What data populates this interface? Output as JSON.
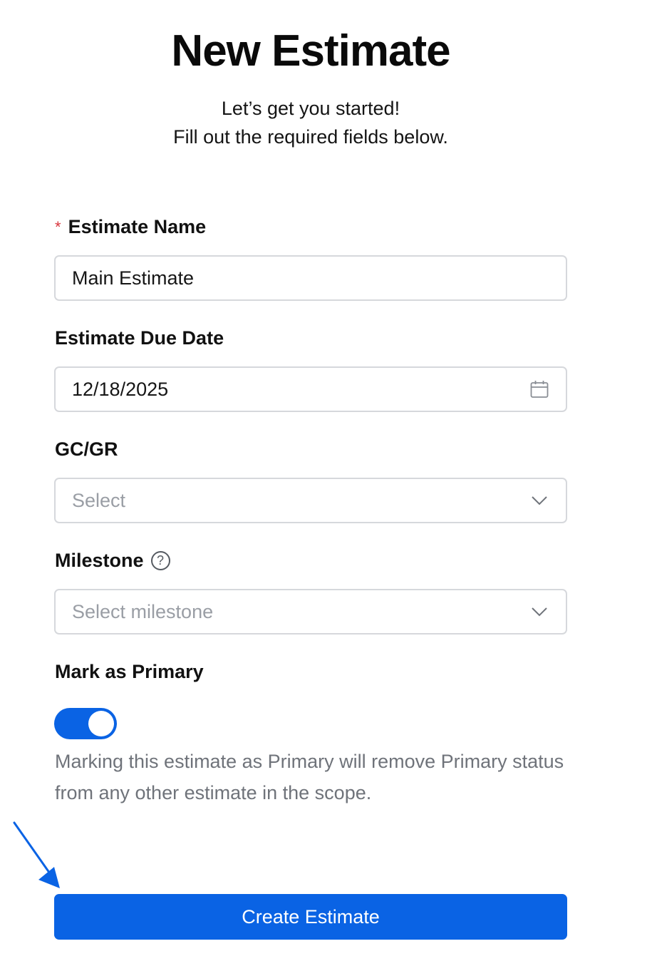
{
  "header": {
    "title": "New Estimate",
    "subtitle_line1": "Let’s get you started!",
    "subtitle_line2": "Fill out the required fields below."
  },
  "form": {
    "estimate_name": {
      "required_marker": "*",
      "label": "Estimate Name",
      "value": "Main Estimate"
    },
    "due_date": {
      "label": "Estimate Due Date",
      "value": "12/18/2025",
      "icon": "calendar-icon"
    },
    "gc_gr": {
      "label": "GC/GR",
      "placeholder": "Select",
      "icon": "chevron-down-icon"
    },
    "milestone": {
      "label": "Milestone",
      "help_glyph": "?",
      "placeholder": "Select milestone",
      "icon": "chevron-down-icon"
    },
    "primary": {
      "label": "Mark as Primary",
      "enabled": true,
      "helper_text": "Marking this estimate as Primary will remove Primary status from any other estimate in the scope."
    }
  },
  "actions": {
    "create_label": "Create Estimate"
  },
  "colors": {
    "accent": "#0a63e4",
    "required": "#d9363e",
    "border": "#d6d8dc",
    "placeholder": "#9a9ea5",
    "helper": "#6f737a"
  }
}
